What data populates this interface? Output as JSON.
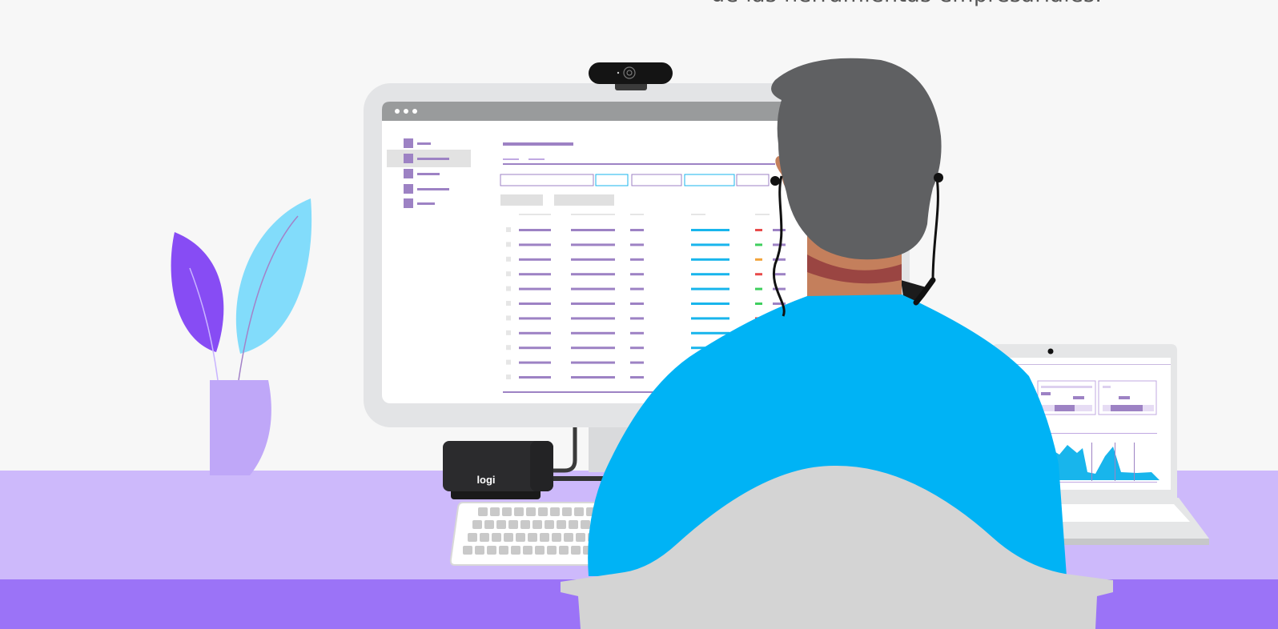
{
  "caption": {
    "text": "de las herramientas empresariales."
  },
  "dock": {
    "brand": "logi"
  },
  "colors": {
    "background": "#f7f7f7",
    "desk_top": "#cdb9fb",
    "desk_front": "#9b73f7",
    "monitor_frame": "#e3e4e6",
    "window_titlebar": "#999b9c",
    "ui_purple": "#9d82c4",
    "ui_cyan": "#18b5ec",
    "status_red": "#e84b4b",
    "status_green": "#3fcf5e",
    "status_orange": "#f2a33a",
    "shirt": "#00b3f5",
    "hair": "#5f6062",
    "skin": "#c47f5c",
    "chair": "#d4d4d4",
    "leaf_violet": "#874cf4",
    "leaf_cyan": "#82dcfb",
    "vase": "#bfa7f8",
    "dock_device": "#2b2b2d"
  },
  "monitor_app": {
    "sidebar_items": 5,
    "selected_sidebar_index": 1,
    "table_rows": 11,
    "row_status_colors": [
      "red",
      "green",
      "orange",
      "red",
      "green",
      "green",
      "red",
      "none",
      "none",
      "none",
      "none"
    ]
  },
  "icons": [
    "webcam-icon",
    "window-control-dots-icon",
    "plant-icon",
    "keyboard-icon",
    "headset-icon",
    "laptop-camera-icon"
  ]
}
